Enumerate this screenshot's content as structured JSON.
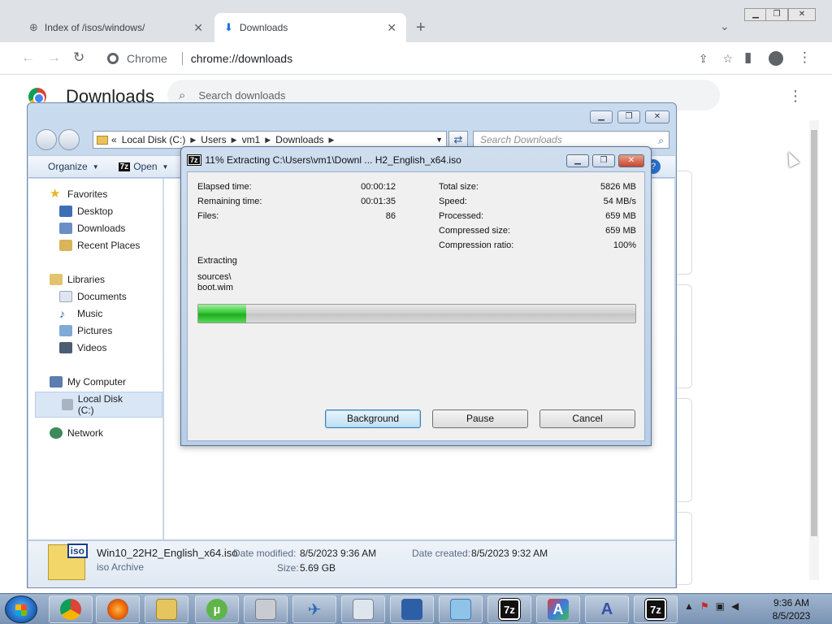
{
  "browser": {
    "tabs": [
      {
        "title": "Index of /isos/windows/",
        "icon": "globe-icon",
        "active": false
      },
      {
        "title": "Downloads",
        "icon": "download-icon",
        "active": true
      }
    ],
    "omnibox": {
      "chip": "Chrome",
      "url": "chrome://downloads"
    },
    "page": {
      "title": "Downloads",
      "search_placeholder": "Search downloads"
    }
  },
  "explorer": {
    "address": {
      "prefix": "«",
      "crumbs": [
        "Local Disk (C:)",
        "Users",
        "vm1",
        "Downloads"
      ]
    },
    "search_placeholder": "Search Downloads",
    "commands": {
      "organize": "Organize",
      "open": "Open"
    },
    "nav": {
      "favorites": "Favorites",
      "desktop": "Desktop",
      "downloads": "Downloads",
      "recent": "Recent Places",
      "libraries": "Libraries",
      "documents": "Documents",
      "music": "Music",
      "pictures": "Pictures",
      "videos": "Videos",
      "computer": "My Computer",
      "local_disk": "Local Disk (C:)",
      "network": "Network"
    },
    "details": {
      "icon_label": "iso",
      "filename": "Win10_22H2_English_x64.iso",
      "type": "iso Archive",
      "date_modified_label": "Date modified:",
      "date_modified": "8/5/2023 9:36 AM",
      "date_created_label": "Date created:",
      "date_created": "8/5/2023 9:32 AM",
      "size_label": "Size:",
      "size": "5.69 GB"
    }
  },
  "zip_dialog": {
    "title": "11% Extracting C:\\Users\\vm1\\Downl ... H2_English_x64.iso",
    "icon_label": "7z",
    "left": [
      {
        "label": "Elapsed time:",
        "value": "00:00:12"
      },
      {
        "label": "Remaining time:",
        "value": "00:01:35"
      },
      {
        "label": "Files:",
        "value": "86"
      }
    ],
    "right": [
      {
        "label": "Total size:",
        "value": "5826 MB"
      },
      {
        "label": "Speed:",
        "value": "54 MB/s"
      },
      {
        "label": "Processed:",
        "value": "659 MB"
      },
      {
        "label": "Compressed size:",
        "value": "659 MB"
      },
      {
        "label": "Compression ratio:",
        "value": "100%"
      }
    ],
    "status": "Extracting",
    "path_line1": "sources\\",
    "path_line2": "boot.wim",
    "progress": 0.11,
    "buttons": {
      "background": "Background",
      "pause": "Pause",
      "cancel": "Cancel"
    }
  },
  "taskbar": {
    "apps": [
      "chrome-icon",
      "firefox-icon",
      "explorer-icon",
      "utorrent-icon",
      "printer-icon",
      "mail-icon",
      "calculator-icon",
      "network-icon",
      "archive-icon",
      "7zip-icon",
      "font-icon",
      "app-icon",
      "7zip-icon"
    ],
    "labels": {
      "sevenzip": "7z"
    },
    "clock": {
      "time": "9:36 AM",
      "date": "8/5/2023"
    }
  }
}
